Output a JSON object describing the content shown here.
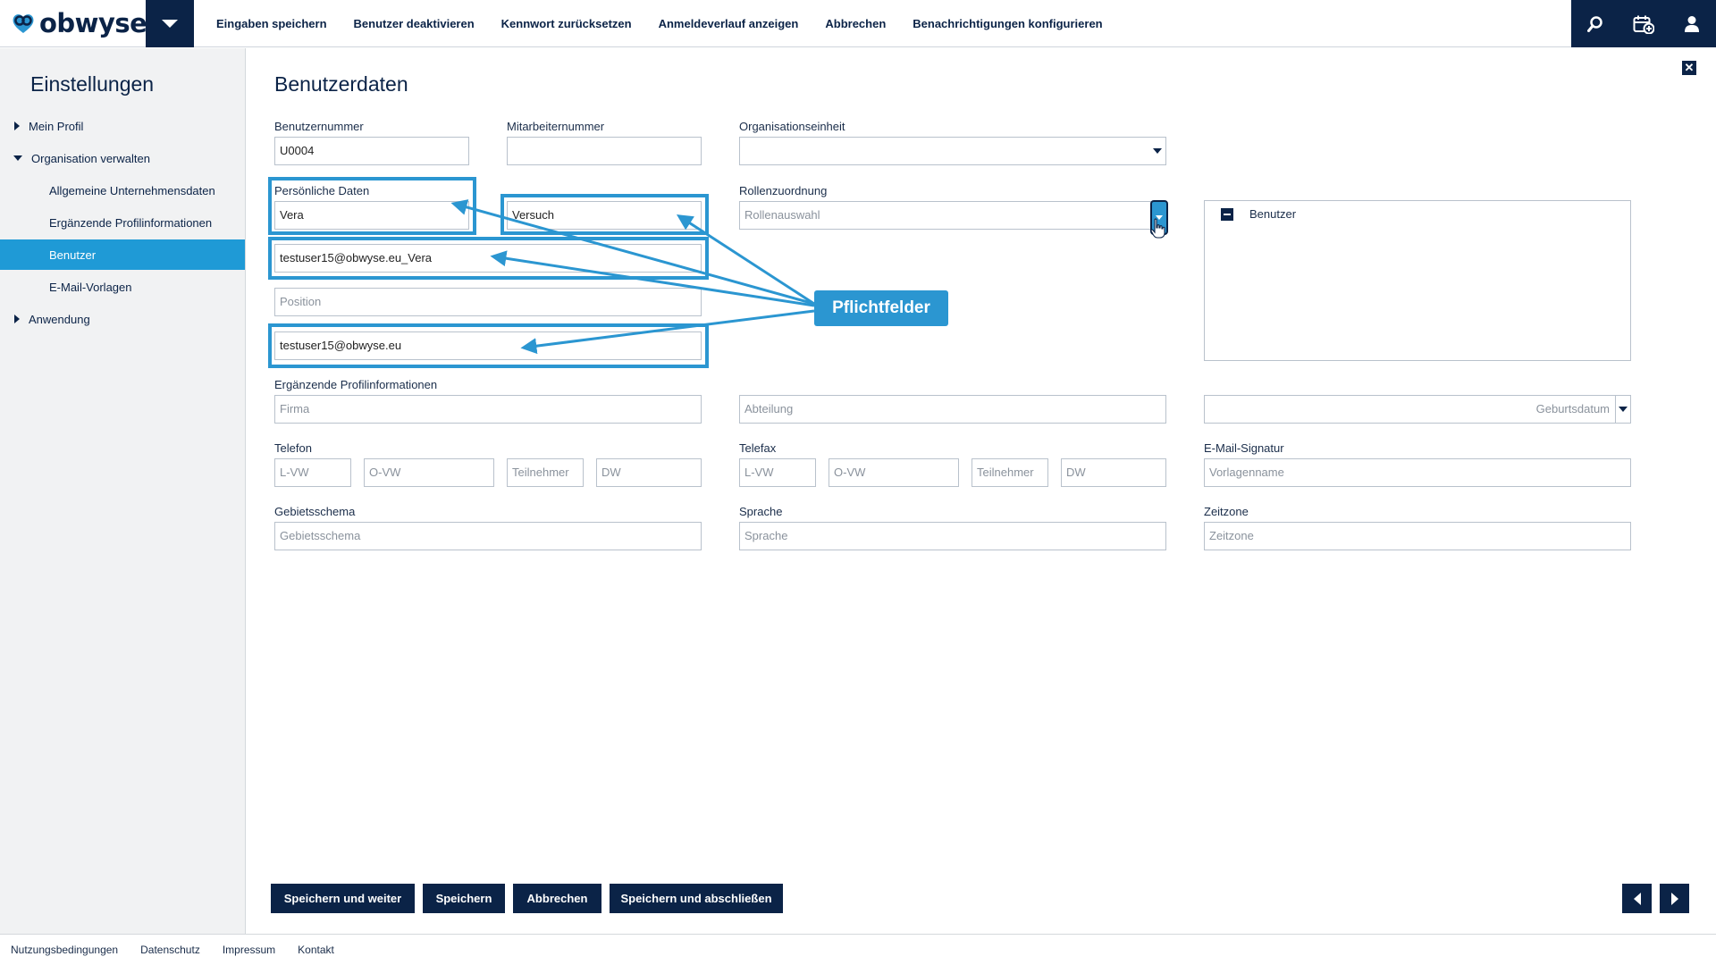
{
  "brand": {
    "name": "obwyse"
  },
  "toolbar": {
    "actions": [
      "Eingaben speichern",
      "Benutzer deaktivieren",
      "Kennwort zurücksetzen",
      "Anmeldeverlauf anzeigen",
      "Abbrechen",
      "Benachrichtigungen konfigurieren"
    ],
    "icons": [
      "search-icon",
      "calendar-add-icon",
      "user-icon"
    ]
  },
  "sidebar": {
    "title": "Einstellungen",
    "items": [
      {
        "label": "Mein Profil",
        "level": 0,
        "expanded": false
      },
      {
        "label": "Organisation verwalten",
        "level": 0,
        "expanded": true
      },
      {
        "label": "Allgemeine Unternehmensdaten",
        "level": 1
      },
      {
        "label": "Ergänzende Profilinformationen",
        "level": 1
      },
      {
        "label": "Benutzer",
        "level": 1,
        "active": true
      },
      {
        "label": "E-Mail-Vorlagen",
        "level": 1
      },
      {
        "label": "Anwendung",
        "level": 0,
        "expanded": false
      }
    ]
  },
  "main": {
    "title": "Benutzerdaten",
    "user_number": {
      "label": "Benutzernummer",
      "value": "U0004"
    },
    "employee_number": {
      "label": "Mitarbeiternummer",
      "value": ""
    },
    "org_unit": {
      "label": "Organisationseinheit",
      "value": ""
    },
    "personal": {
      "label": "Persönliche Daten",
      "first_name": "Vera",
      "last_name": "Versuch",
      "login": "testuser15@obwyse.eu_Vera",
      "position_placeholder": "Position",
      "email": "testuser15@obwyse.eu"
    },
    "roles": {
      "label": "Rollenzuordnung",
      "placeholder": "Rollenauswahl",
      "tree": [
        {
          "label": "Benutzer"
        }
      ]
    },
    "profile_info": {
      "label": "Ergänzende Profilinformationen",
      "company_placeholder": "Firma",
      "department_placeholder": "Abteilung",
      "birthday_placeholder": "Geburtsdatum"
    },
    "phone": {
      "label": "Telefon",
      "country_placeholder": "L-VW",
      "area_placeholder": "O-VW",
      "subscriber_placeholder": "Teilnehmer",
      "ext_placeholder": "DW"
    },
    "fax": {
      "label": "Telefax",
      "country_placeholder": "L-VW",
      "area_placeholder": "O-VW",
      "subscriber_placeholder": "Teilnehmer",
      "ext_placeholder": "DW"
    },
    "signature": {
      "label": "E-Mail-Signatur",
      "placeholder": "Vorlagenname"
    },
    "region": {
      "label": "Gebietsschema",
      "placeholder": "Gebietsschema"
    },
    "language": {
      "label": "Sprache",
      "placeholder": "Sprache"
    },
    "timezone": {
      "label": "Zeitzone",
      "placeholder": "Zeitzone"
    },
    "callout": "Pflichtfelder"
  },
  "buttons": {
    "save_continue": "Speichern und weiter",
    "save": "Speichern",
    "cancel": "Abbrechen",
    "save_close": "Speichern und abschließen"
  },
  "footer": {
    "links": [
      "Nutzungsbedingungen",
      "Datenschutz",
      "Impressum",
      "Kontakt"
    ]
  },
  "colors": {
    "navy": "#0b2347",
    "accent": "#2b96d1",
    "active": "#1f9ad6"
  }
}
